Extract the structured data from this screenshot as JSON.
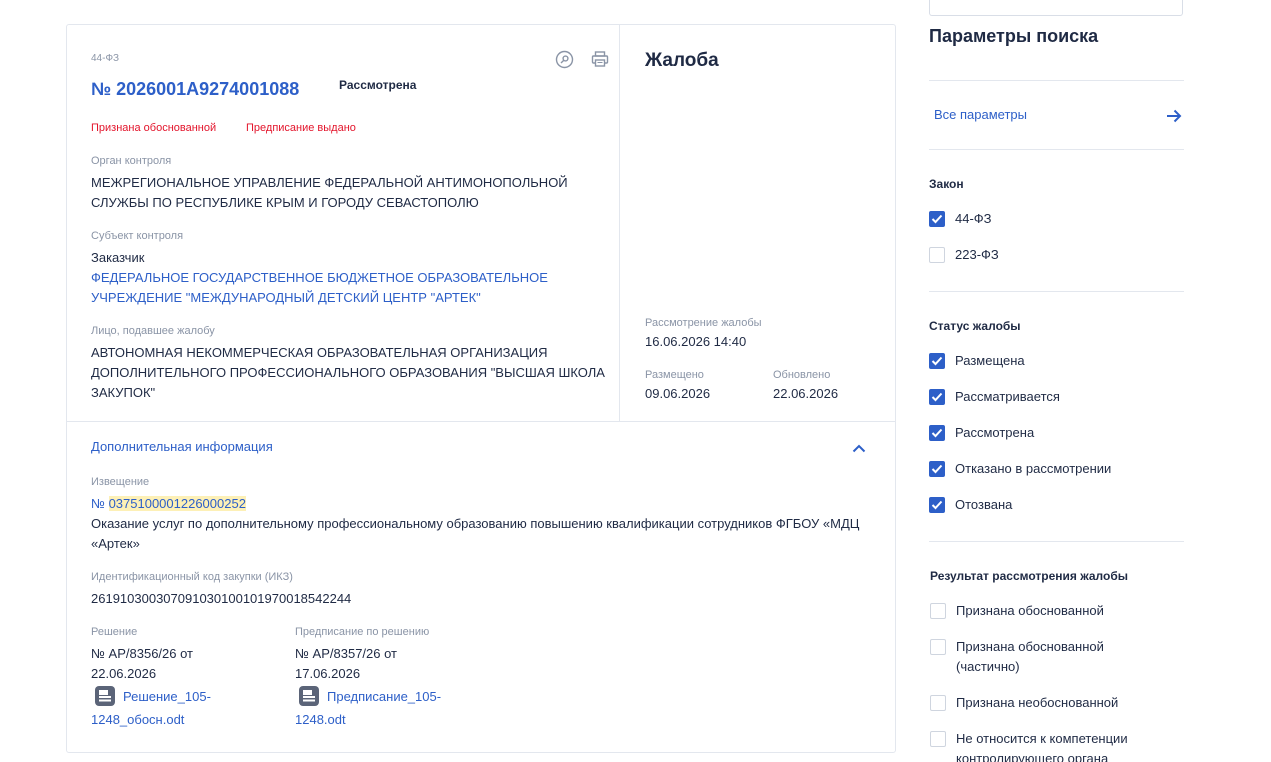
{
  "card": {
    "law": "44-ФЗ",
    "registry_number": "№ 2026001A9274001088",
    "status": "Рассмотрена",
    "tags": [
      "Признана обоснованной",
      "Предписание выдано"
    ],
    "control_body": {
      "label": "Орган контроля",
      "value": "МЕЖРЕГИОНАЛЬНОЕ УПРАВЛЕНИЕ ФЕДЕРАЛЬНОЙ АНТИМОНОПОЛЬНОЙ СЛУЖБЫ ПО РЕСПУБЛИКЕ КРЫМ И ГОРОДУ СЕВАСТОПОЛЮ"
    },
    "control_subject": {
      "label": "Субъект контроля",
      "role": "Заказчик",
      "name": "ФЕДЕРАЛЬНОЕ ГОСУДАРСТВЕННОЕ БЮДЖЕТНОЕ ОБРАЗОВАТЕЛЬНОЕ УЧРЕЖДЕНИЕ \"МЕЖДУНАРОДНЫЙ ДЕТСКИЙ ЦЕНТР \"АРТЕК\""
    },
    "complainant": {
      "label": "Лицо, подавшее жалобу",
      "value": "АВТОНОМНАЯ НЕКОММЕРЧЕСКАЯ ОБРАЗОВАТЕЛЬНАЯ ОРГАНИЗАЦИЯ ДОПОЛНИТЕЛЬНОГО ПРОФЕССИОНАЛЬНОГО ОБРАЗОВАНИЯ \"ВЫСШАЯ ШКОЛА ЗАКУПОК\""
    },
    "complaint": {
      "title": "Жалоба",
      "review_label": "Рассмотрение жалобы",
      "review_value": "16.06.2026 14:40",
      "placed_label": "Размещено",
      "placed_value": "09.06.2026",
      "updated_label": "Обновлено",
      "updated_value": "22.06.2026"
    },
    "additional": {
      "title": "Дополнительная информация",
      "notice_label": "Извещение",
      "notice_prefix": "№ ",
      "notice_number": "0375100001226000252",
      "notice_desc": "Оказание услуг по дополнительному профессиональному образованию повышению квалификации сотрудников ФГБОУ «МДЦ «Артек»",
      "ikz_label": "Идентификационный код закупки (ИКЗ)",
      "ikz_value": "261910300307091030100101970018542244",
      "decision_label": "Решение",
      "decision_value": "№ АР/8356/26 от 22.06.2026",
      "decision_file": "Решение_105-1248_обосн.odt",
      "order_label": "Предписание по решению",
      "order_value": "№ АР/8357/26 от 17.06.2026",
      "order_file": "Предписание_105-1248.odt"
    }
  },
  "sidebar": {
    "title": "Параметры поиска",
    "all_params": "Все параметры",
    "law_section": {
      "title": "Закон",
      "items": [
        {
          "label": "44-ФЗ",
          "checked": true
        },
        {
          "label": "223-ФЗ",
          "checked": false
        }
      ]
    },
    "status_section": {
      "title": "Статус жалобы",
      "items": [
        {
          "label": "Размещена",
          "checked": true
        },
        {
          "label": "Рассматривается",
          "checked": true
        },
        {
          "label": "Рассмотрена",
          "checked": true
        },
        {
          "label": "Отказано в рассмотрении",
          "checked": true
        },
        {
          "label": "Отозвана",
          "checked": true
        }
      ]
    },
    "result_section": {
      "title": "Результат рассмотрения жалобы",
      "items": [
        {
          "label": "Признана обоснованной",
          "checked": false
        },
        {
          "label": "Признана обоснованной (частично)",
          "checked": false
        },
        {
          "label": "Признана необоснованной",
          "checked": false
        },
        {
          "label": "Не относится к компетенции контролирующего органа",
          "checked": false
        }
      ]
    }
  },
  "colors": {
    "accent": "#2d5fc8",
    "alert": "#e3142b",
    "highlight": "#fdf0b6"
  }
}
